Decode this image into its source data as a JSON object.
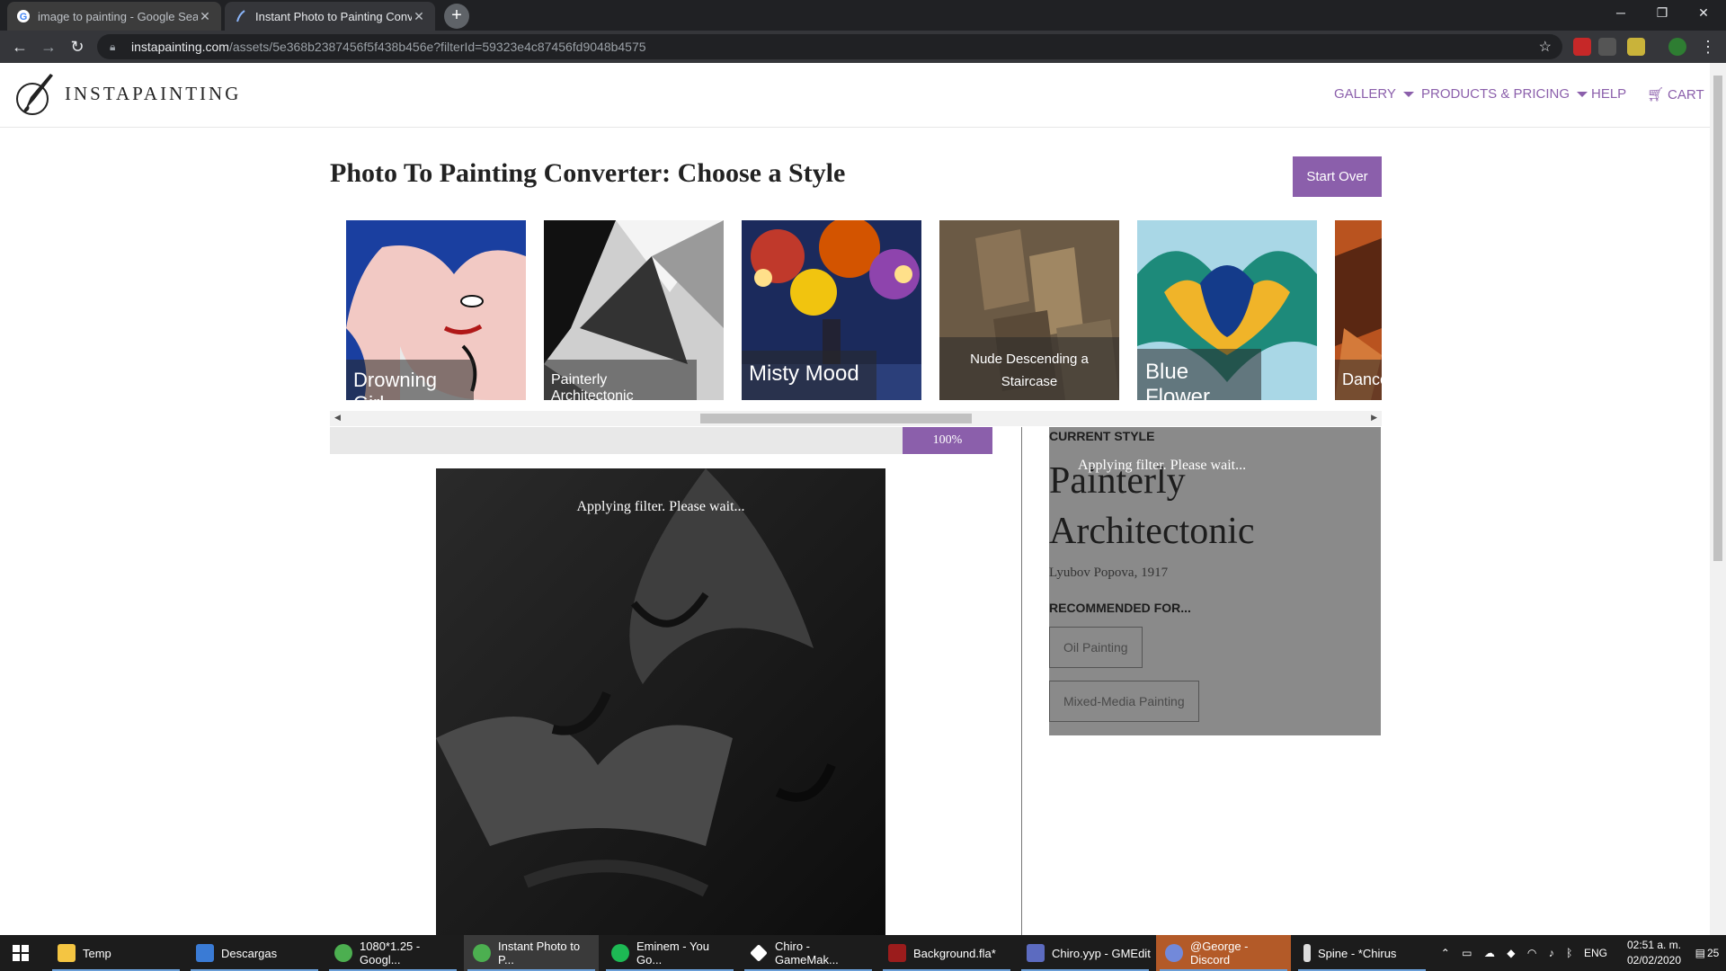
{
  "browser": {
    "tabs": [
      {
        "title": "image to painting - Google Search",
        "active": false
      },
      {
        "title": "Instant Photo to Painting Converter",
        "active": true
      }
    ],
    "url_host": "instapainting.com",
    "url_path": "/assets/5e368b2387456f5f438b456e?filterId=59323e4c87456fd9048b4575"
  },
  "site": {
    "logo_text": "INSTAPAINTING",
    "nav": {
      "gallery": "GALLERY",
      "products": "PRODUCTS & PRICING",
      "help": "HELP",
      "cart": "CART"
    },
    "accent_color": "#8b5fab"
  },
  "page": {
    "title": "Photo To Painting Converter: Choose a Style",
    "start_over": "Start Over",
    "styles": [
      {
        "name": "Drowning Girl"
      },
      {
        "name": "Painterly Architectonic"
      },
      {
        "name": "Misty Mood"
      },
      {
        "name": "Nude Descending a Staircase"
      },
      {
        "name": "Blue Flower"
      },
      {
        "name": "Dance"
      }
    ],
    "progress_label": "100%",
    "progress_fraction": 1.0,
    "preview_message": "Applying filter. Please wait...",
    "current_style": {
      "heading": "CURRENT STYLE",
      "overlay_message": "Applying filter. Please wait...",
      "name": "Painterly Architectonic",
      "artist": "Lyubov Popova, 1917",
      "recommended_heading": "RECOMMENDED FOR...",
      "recommended": [
        "Oil Painting",
        "Mixed-Media Painting"
      ]
    }
  },
  "taskbar": {
    "items": [
      {
        "label": "Temp"
      },
      {
        "label": "Descargas"
      },
      {
        "label": "1080*1.25 - Googl..."
      },
      {
        "label": "Instant Photo to P..."
      },
      {
        "label": "Eminem - You Go..."
      },
      {
        "label": "Chiro - GameMak..."
      },
      {
        "label": "Background.fla*"
      },
      {
        "label": "Chiro.yyp - GMEdit"
      },
      {
        "label": "@George - Discord"
      },
      {
        "label": "Spine - *Chirus"
      }
    ],
    "language": "ENG",
    "time": "02:51 a. m.",
    "date": "02/02/2020",
    "notification_count": "25"
  }
}
